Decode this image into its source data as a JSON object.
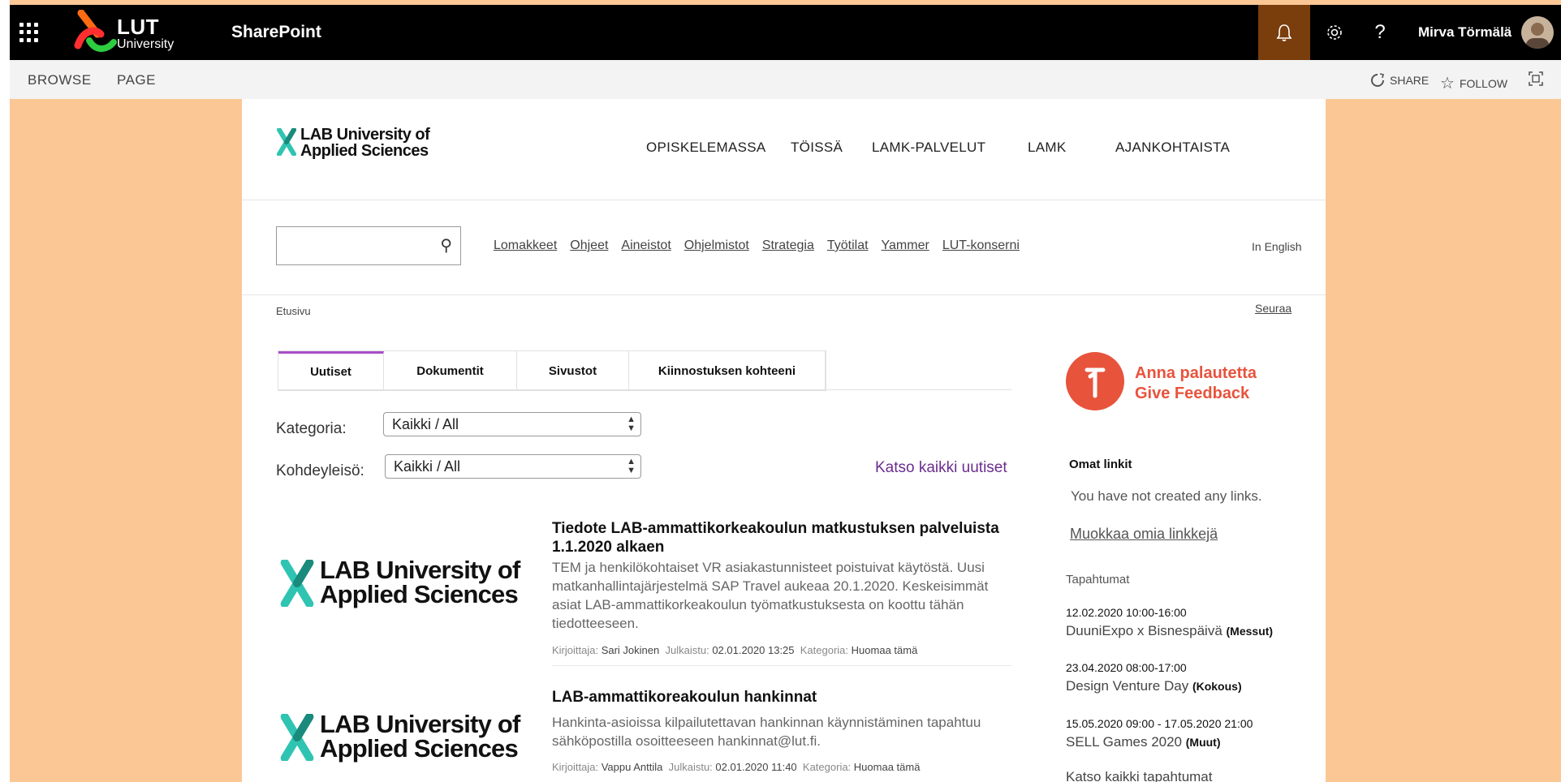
{
  "suite_bar": {
    "brand_line1": "LUT",
    "brand_line2": "University",
    "app_name": "SharePoint",
    "user_name": "Mirva Törmälä",
    "icons": [
      "app-launcher-icon",
      "bell-icon",
      "gear-icon",
      "help-icon"
    ],
    "help_glyph": "?",
    "accent_color": "#7a3d0c"
  },
  "ribbon": {
    "browse": "BROWSE",
    "page": "PAGE",
    "share": "SHARE",
    "follow": "FOLLOW"
  },
  "site": {
    "logo_line1": "LAB University of",
    "logo_line2": "Applied Sciences",
    "nav": [
      "OPISKELEMASSA",
      "TÖISSÄ",
      "LAMK-PALVELUT",
      "LAMK",
      "AJANKOHTAISTA"
    ],
    "search_placeholder": "",
    "quick_links": [
      "Lomakkeet",
      "Ohjeet",
      "Aineistot",
      "Ohjelmistot",
      "Strategia",
      "Työtilat",
      "Yammer",
      "LUT-konserni"
    ],
    "language_link": "In English",
    "breadcrumb": "Etusivu",
    "follow_link": "Seuraa"
  },
  "tabs": [
    {
      "label": "Uutiset",
      "active": true
    },
    {
      "label": "Dokumentit",
      "active": false
    },
    {
      "label": "Sivustot",
      "active": false
    },
    {
      "label": "Kiinnostuksen kohteeni",
      "active": false
    }
  ],
  "filters": {
    "category_label": "Kategoria:",
    "category_value": "Kaikki / All",
    "audience_label": "Kohdeyleisö:",
    "audience_value": "Kaikki / All",
    "all_news": "Katso kaikki uutiset"
  },
  "news": [
    {
      "title": "Tiedote LAB-ammattikorkeakoulun matkustuksen palveluista 1.1.2020 alkaen",
      "body": "TEM ja henkilökohtaiset VR asiakastunnisteet poistuivat käytöstä. Uusi matkanhallintajärjestelmä SAP Travel aukeaa 20.1.2020. Keskeisimmät asiat LAB-ammattikorkeakoulun työmatkustuksesta on koottu tähän tiedotteeseen.",
      "author_label": "Kirjoittaja:",
      "author": "Sari Jokinen",
      "published_label": "Julkaistu:",
      "published": "02.01.2020 13:25",
      "category_label": "Kategoria:",
      "category": "Huomaa tämä",
      "image_line1": "LAB University of",
      "image_line2": "Applied Sciences"
    },
    {
      "title": "LAB-ammattikoreakoulun hankinnat",
      "body": "Hankinta-asioissa kilpailutettavan hankinnan käynnistäminen tapahtuu sähköpostilla osoitteeseen hankinnat@lut.fi.",
      "author_label": "Kirjoittaja:",
      "author": "Vappu Anttila",
      "published_label": "Julkaistu:",
      "published": "02.01.2020 11:40",
      "category_label": "Kategoria:",
      "category": "Huomaa tämä",
      "image_line1": "LAB University of",
      "image_line2": "Applied Sciences"
    }
  ],
  "sidebar": {
    "feedback_line1": "Anna palautetta",
    "feedback_line2": "Give Feedback",
    "feedback_color": "#e8533c",
    "own_links_title": "Omat linkit",
    "own_links_empty": "You have not created any links.",
    "edit_links": "Muokkaa omia linkkejä",
    "events_title": "Tapahtumat",
    "events": [
      {
        "date": "12.02.2020 10:00-16:00",
        "title": "DuuniExpo x Bisnespäivä",
        "type": "(Messut)"
      },
      {
        "date": "23.04.2020 08:00-17:00",
        "title": "Design Venture Day",
        "type": "(Kokous)"
      },
      {
        "date": "15.05.2020 09:00 - 17.05.2020 21:00",
        "title": "SELL Games 2020",
        "type": "(Muut)"
      }
    ],
    "all_events": "Katso kaikki tapahtumat"
  }
}
